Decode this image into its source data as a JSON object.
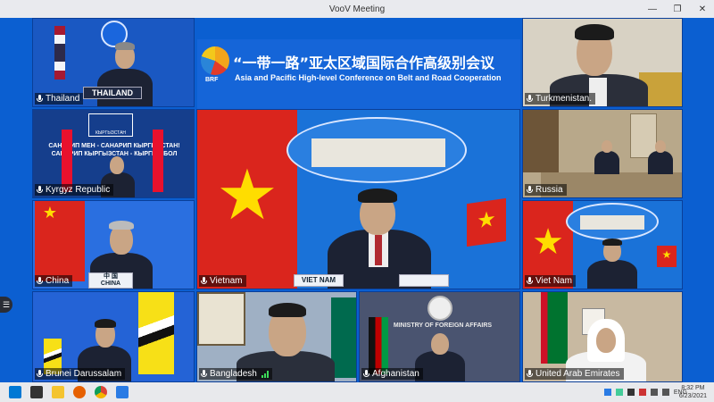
{
  "window": {
    "title": "VooV Meeting"
  },
  "banner": {
    "logo_text": "BRF",
    "title_cn": "“一带一路”亚太区域国际合作高级别会议",
    "title_en": "Asia and Pacific High-level Conference on Belt and Road Cooperation"
  },
  "tiles": [
    {
      "label": "Thailand",
      "nameplate": "THAILAND"
    },
    {
      "label": "Turkmenistan."
    },
    {
      "label": "Kyrgyz Republic",
      "backdrop": "САНАРИП МЕН - САНАРИП КЫРГЫЗСТАН! САНАРИП КЫРГЫЗСТАН - КЫРГЫЗ БОЛ",
      "emblem_text": "КЫРГЫЗСТАН"
    },
    {
      "label": "Vietnam",
      "nameplate": "VIET NAM"
    },
    {
      "label": "Russia"
    },
    {
      "label": "China",
      "nameplate": "中 国\nCHINA"
    },
    {
      "label": "Viet Nam"
    },
    {
      "label": "Viet Nam"
    },
    {
      "label": "Brunei Darussalam"
    },
    {
      "label": "Bangladesh"
    },
    {
      "label": "Afghanistan",
      "backdrop": "MINISTRY OF FOREIGN AFFAIRS"
    },
    {
      "label": "United Arab Emirates"
    }
  ],
  "taskbar": {
    "lang": "ENG",
    "time": "8:32 PM",
    "date": "6/23/2021"
  },
  "colors": {
    "stage": "#0b5fd1",
    "vn_red": "#da251d",
    "vn_star": "#ffdd00"
  }
}
